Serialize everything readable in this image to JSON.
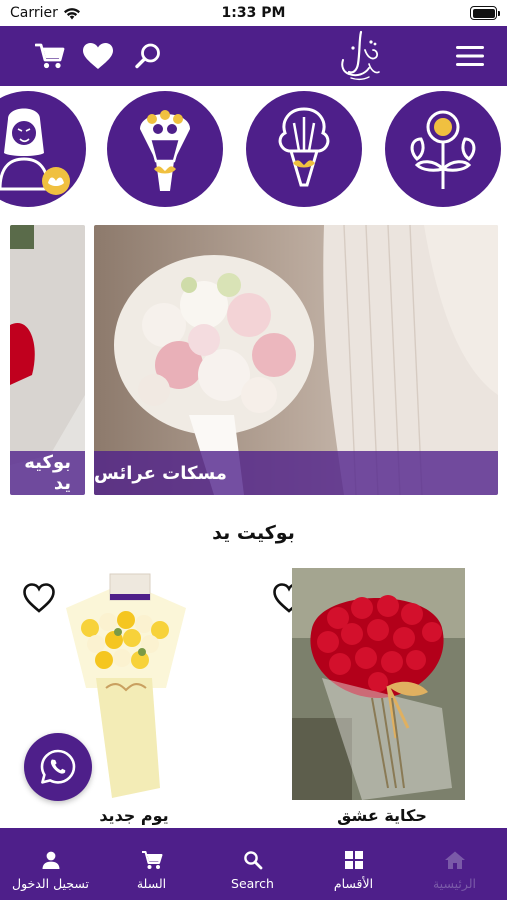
{
  "status_bar": {
    "carrier": "Carrier",
    "time": "1:33 PM"
  },
  "header": {
    "icons": [
      "cart-icon",
      "heart-icon",
      "search-icon",
      "logo",
      "menu-icon"
    ]
  },
  "categories": [
    {
      "icon": "bride-icon"
    },
    {
      "icon": "round-bouquet-icon"
    },
    {
      "icon": "flower-bouquet-icon"
    },
    {
      "icon": "flowers-icon"
    }
  ],
  "banners": [
    {
      "caption": "بوكيه يد"
    },
    {
      "caption": "مسكات عرائس"
    }
  ],
  "section": {
    "title": "بوكيت يد"
  },
  "products": [
    {
      "name": "يوم جديد",
      "favorite": false
    },
    {
      "name": "حكاية عشق",
      "favorite": false
    }
  ],
  "tabbar": {
    "items": [
      {
        "label": "تسجيل الدخول",
        "icon": "person-icon",
        "active": true
      },
      {
        "label": "السلة",
        "icon": "cart-icon",
        "active": true
      },
      {
        "label": "Search",
        "icon": "search-icon",
        "active": true
      },
      {
        "label": "الأقسام",
        "icon": "grid-icon",
        "active": true
      },
      {
        "label": "الرئيسية",
        "icon": "home-icon",
        "active": false
      }
    ]
  },
  "colors": {
    "brand": "#4e1f8a",
    "inactive_tab": "#7a5aa8"
  }
}
